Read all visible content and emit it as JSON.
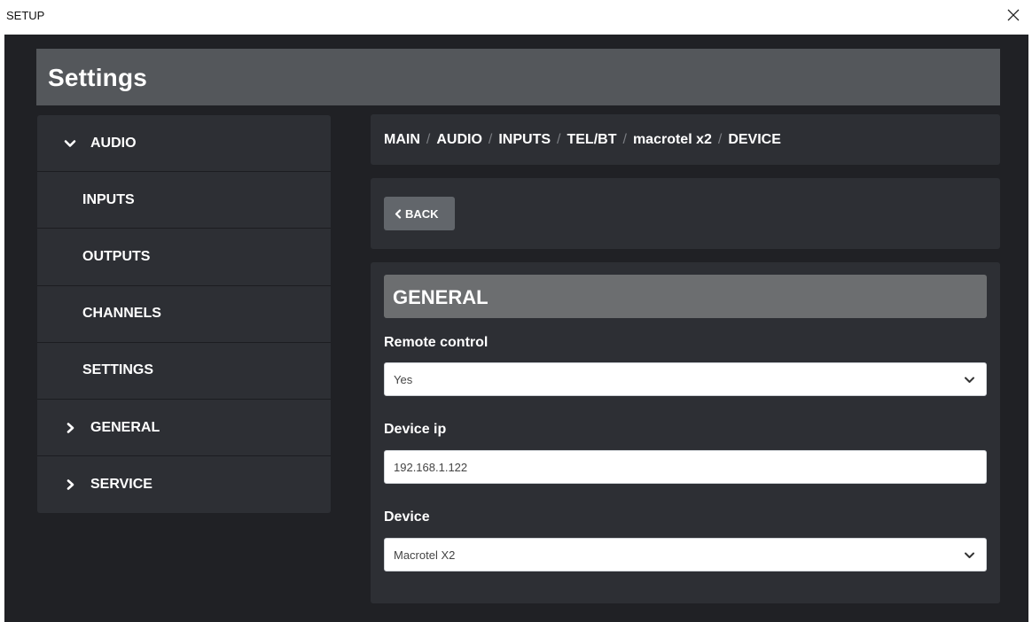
{
  "window": {
    "title": "SETUP",
    "close_icon": "close-icon"
  },
  "header": {
    "title": "Settings"
  },
  "sidebar": {
    "items": [
      {
        "label": "AUDIO",
        "icon": "chevron-down-icon",
        "level": "top",
        "expanded": true
      },
      {
        "label": "INPUTS",
        "level": "sub"
      },
      {
        "label": "OUTPUTS",
        "level": "sub"
      },
      {
        "label": "CHANNELS",
        "level": "sub"
      },
      {
        "label": "SETTINGS",
        "level": "sub"
      },
      {
        "label": "GENERAL",
        "icon": "chevron-right-icon",
        "level": "top",
        "expanded": false
      },
      {
        "label": "SERVICE",
        "icon": "chevron-right-icon",
        "level": "top",
        "expanded": false
      }
    ]
  },
  "breadcrumb": {
    "items": [
      "MAIN",
      "AUDIO",
      "INPUTS",
      "TEL/BT",
      "macrotel x2",
      "DEVICE"
    ],
    "separator": "/"
  },
  "back_button": {
    "label": "BACK",
    "icon": "chevron-left-icon"
  },
  "panel": {
    "title": "GENERAL",
    "fields": {
      "remote_control": {
        "label": "Remote control",
        "value": "Yes",
        "type": "select"
      },
      "device_ip": {
        "label": "Device ip",
        "value": "192.168.1.122",
        "type": "text"
      },
      "device": {
        "label": "Device",
        "value": "Macrotel X2",
        "type": "select"
      }
    }
  },
  "colors": {
    "app_background": "#202125",
    "panel_background": "#2d2f34",
    "header_background": "#54575b",
    "section_header": "#6c6e70",
    "button": "#62666b",
    "text": "#ffffff"
  }
}
